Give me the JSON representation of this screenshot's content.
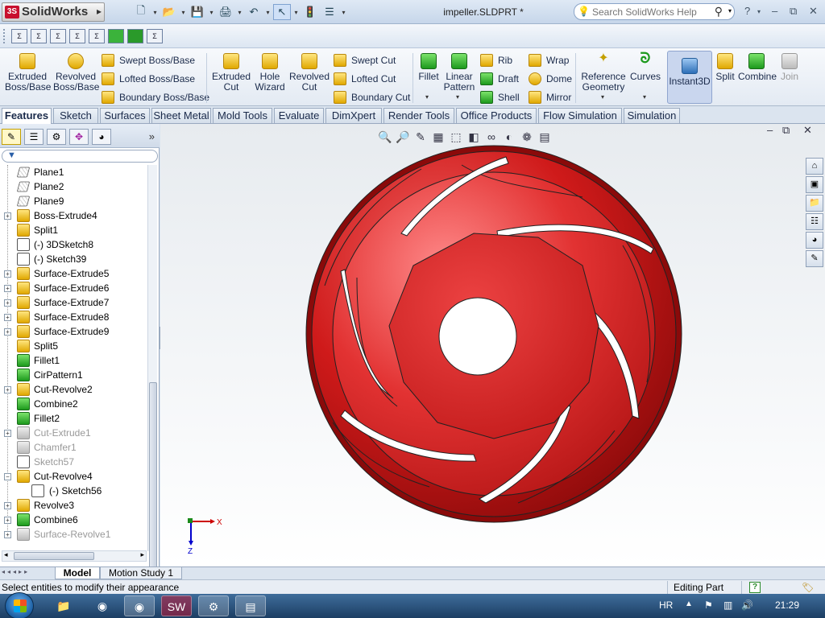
{
  "app": {
    "logo_text": "SolidWorks",
    "doc_title": "impeller.SLDPRT *",
    "search_placeholder": "Search SolidWorks Help"
  },
  "command_manager": {
    "features": {
      "extruded_boss": "Extruded Boss/Base",
      "revolved_boss": "Revolved Boss/Base",
      "swept_boss": "Swept Boss/Base",
      "lofted_boss": "Lofted Boss/Base",
      "boundary_boss": "Boundary Boss/Base",
      "extruded_cut": "Extruded Cut",
      "hole_wizard": "Hole Wizard",
      "revolved_cut": "Revolved Cut",
      "swept_cut": "Swept Cut",
      "lofted_cut": "Lofted Cut",
      "boundary_cut": "Boundary Cut",
      "fillet": "Fillet",
      "linear_pattern": "Linear Pattern",
      "rib": "Rib",
      "draft": "Draft",
      "shell": "Shell",
      "wrap": "Wrap",
      "dome": "Dome",
      "mirror": "Mirror",
      "reference_geometry": "Reference Geometry",
      "curves": "Curves",
      "instant3d": "Instant3D",
      "split": "Split",
      "combine": "Combine",
      "join": "Join"
    }
  },
  "tabs": [
    "Features",
    "Sketch",
    "Surfaces",
    "Sheet Metal",
    "Mold Tools",
    "Evaluate",
    "DimXpert",
    "Render Tools",
    "Office Products",
    "Flow Simulation",
    "Simulation"
  ],
  "feature_tree": [
    {
      "label": "Plane1",
      "icon": "plane",
      "expand": false
    },
    {
      "label": "Plane2",
      "icon": "plane",
      "expand": false
    },
    {
      "label": "Plane9",
      "icon": "plane",
      "expand": false
    },
    {
      "label": "Boss-Extrude4",
      "icon": "extrude",
      "expand": true
    },
    {
      "label": "Split1",
      "icon": "split",
      "expand": false
    },
    {
      "label": "(-) 3DSketch8",
      "icon": "sketch3d",
      "expand": false
    },
    {
      "label": "(-) Sketch39",
      "icon": "sketch",
      "expand": false
    },
    {
      "label": "Surface-Extrude5",
      "icon": "surface",
      "expand": true
    },
    {
      "label": "Surface-Extrude6",
      "icon": "surface",
      "expand": true
    },
    {
      "label": "Surface-Extrude7",
      "icon": "surface",
      "expand": true
    },
    {
      "label": "Surface-Extrude8",
      "icon": "surface",
      "expand": true
    },
    {
      "label": "Surface-Extrude9",
      "icon": "surface",
      "expand": true
    },
    {
      "label": "Split5",
      "icon": "split",
      "expand": false
    },
    {
      "label": "Fillet1",
      "icon": "fillet",
      "expand": false
    },
    {
      "label": "CirPattern1",
      "icon": "pattern",
      "expand": false
    },
    {
      "label": "Cut-Revolve2",
      "icon": "cutrev",
      "expand": true
    },
    {
      "label": "Combine2",
      "icon": "combine",
      "expand": false
    },
    {
      "label": "Fillet2",
      "icon": "fillet",
      "expand": false
    },
    {
      "label": "Cut-Extrude1",
      "icon": "cutext",
      "expand": true,
      "dim": true
    },
    {
      "label": "Chamfer1",
      "icon": "chamfer",
      "expand": false,
      "dim": true
    },
    {
      "label": "Sketch57",
      "icon": "sketch",
      "expand": false,
      "dim": true
    },
    {
      "label": "Cut-Revolve4",
      "icon": "cutrev",
      "expand": "open"
    },
    {
      "label": "(-) Sketch56",
      "icon": "sketch",
      "expand": false,
      "sub": true
    },
    {
      "label": "Revolve3",
      "icon": "revolve",
      "expand": true
    },
    {
      "label": "Combine6",
      "icon": "combine",
      "expand": true
    },
    {
      "label": "Surface-Revolve1",
      "icon": "surfrev",
      "expand": true,
      "dim": true
    }
  ],
  "bottom_tabs": [
    "Model",
    "Motion Study 1"
  ],
  "status": {
    "message": "Select entities to modify their appearance",
    "mode": "Editing Part",
    "help": "?"
  },
  "triad": {
    "x_label": "X",
    "z_label": "Z"
  },
  "taskbar": {
    "language": "HR",
    "time": "21:29"
  },
  "colors": {
    "part": "#c8101a",
    "accent": "#2a5fa8"
  }
}
